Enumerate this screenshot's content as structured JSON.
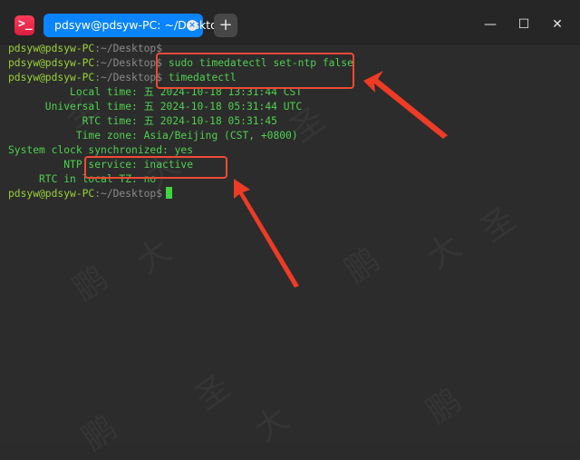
{
  "window": {
    "tab_title": "pdsyw@pdsyw-PC: ~/Desktop",
    "tab_close_glyph": "×",
    "new_tab_glyph": "+",
    "minimize_glyph": "—",
    "maximize_glyph": "☐",
    "close_glyph": "✕",
    "app_icon_glyph": ">_"
  },
  "terminal": {
    "prompt_user": "pdsyw@pdsyw-PC",
    "prompt_path": ":~/Desktop",
    "prompt_symbol": "$",
    "cmd1": " sudo timedatectl set-ntp false",
    "cmd2": " timedatectl",
    "output": [
      "          Local time: 五 2024-10-18 13:31:44 CST",
      "      Universal time: 五 2024-10-18 05:31:44 UTC",
      "            RTC time: 五 2024-10-18 05:31:45",
      "           Time zone: Asia/Beijing (CST, +0800)",
      "System clock synchronized: yes",
      "         NTP service: inactive",
      "     RTC in local TZ: no"
    ]
  },
  "watermark": {
    "chars": [
      "大",
      "圣",
      "鹏",
      "大",
      "圣",
      "鹏",
      "大",
      "圣",
      "鹏",
      "大"
    ]
  },
  "colors": {
    "accent_tab": "#0a84ff",
    "annotation_red": "#ee4a36",
    "terminal_green": "#4fd04f"
  }
}
